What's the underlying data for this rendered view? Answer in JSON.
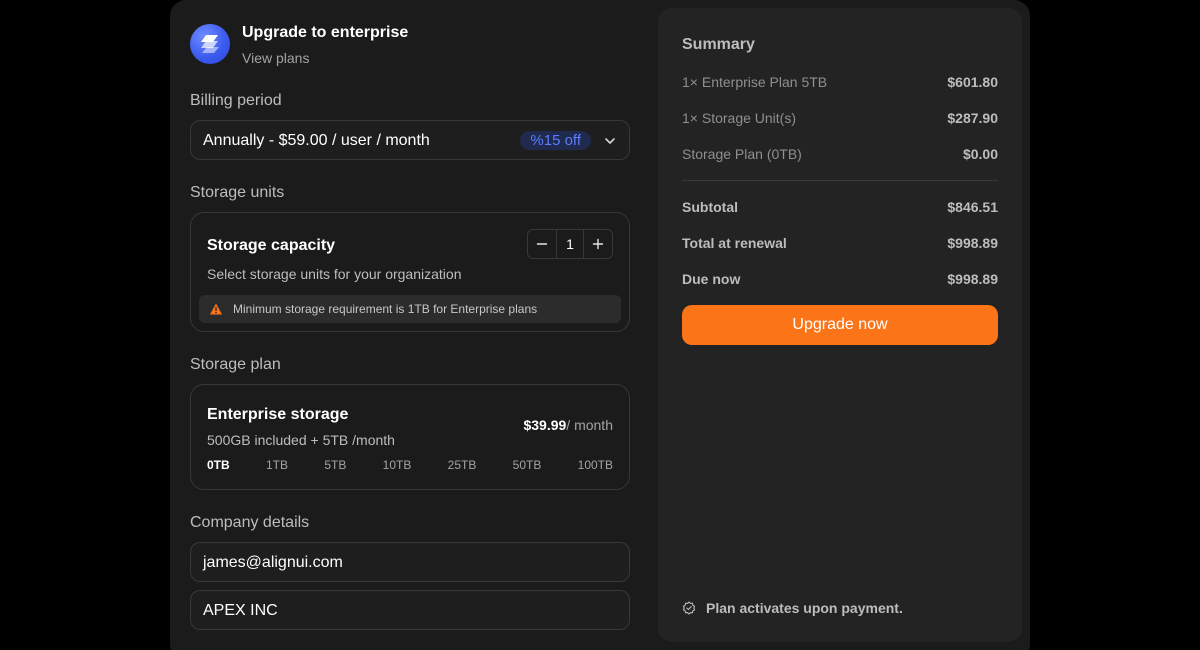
{
  "header": {
    "title": "Upgrade to enterprise",
    "link": "View plans"
  },
  "billing": {
    "label": "Billing period",
    "selected": "Annually - $59.00 / user / month",
    "badge": "%15 off"
  },
  "storage_units": {
    "label": "Storage units",
    "title": "Storage capacity",
    "subtitle": "Select storage units for your organization",
    "quantity": "1",
    "warning": "Minimum storage requirement is 1TB for Enterprise plans"
  },
  "storage_plan": {
    "label": "Storage plan",
    "title": "Enterprise storage",
    "subtitle": "500GB included + 5TB /month",
    "price": "$39.99",
    "per": "/ month",
    "tiers": [
      "0TB",
      "1TB",
      "5TB",
      "10TB",
      "25TB",
      "50TB",
      "100TB"
    ],
    "selected_tier": "0TB"
  },
  "company": {
    "label": "Company details",
    "email": "james@alignui.com",
    "name": "APEX INC"
  },
  "summary": {
    "title": "Summary",
    "items": [
      {
        "label": "1× Enterprise Plan 5TB",
        "value": "$601.80"
      },
      {
        "label": "1× Storage Unit(s)",
        "value": "$287.90"
      },
      {
        "label": "Storage Plan (0TB)",
        "value": "$0.00"
      }
    ],
    "totals": [
      {
        "label": "Subtotal",
        "value": "$846.51"
      },
      {
        "label": "Total at renewal",
        "value": "$998.89"
      },
      {
        "label": "Due now",
        "value": "$998.89"
      }
    ],
    "button": "Upgrade now",
    "note": "Plan activates upon payment."
  },
  "colors": {
    "accent": "#fb7418",
    "badge_text": "#5b7cff",
    "logo": "#3c5cf0"
  },
  "icons": {
    "logo": "layers-logo-icon",
    "chevron": "chevron-down-icon",
    "minus": "minus-icon",
    "plus": "plus-icon",
    "warning": "warning-triangle-icon",
    "note": "badge-check-icon"
  }
}
